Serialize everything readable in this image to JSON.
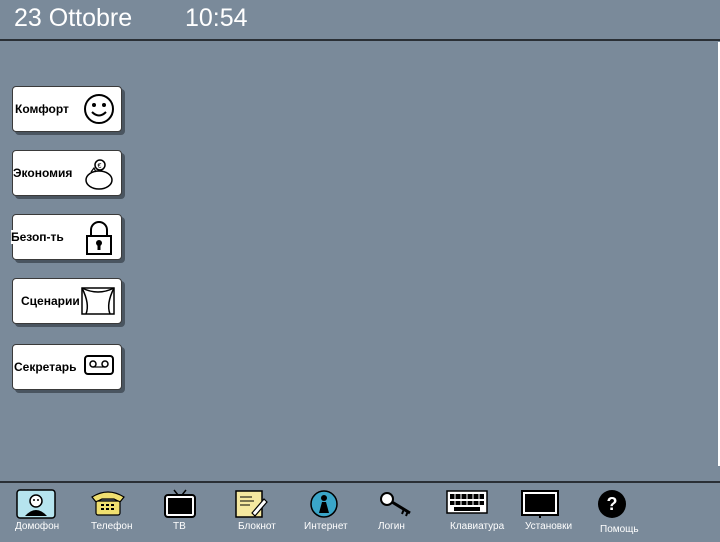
{
  "header": {
    "date": "23  Ottobre",
    "time": "10:54"
  },
  "menu": [
    {
      "label": "Комфорт",
      "icon": "smiley-icon"
    },
    {
      "label": "Экономия",
      "icon": "piggy-bank-icon"
    },
    {
      "label": "Безоп-ть",
      "icon": "padlock-icon"
    },
    {
      "label": "Сценарии",
      "icon": "theater-curtain-icon"
    },
    {
      "label": "Секретарь",
      "icon": "cassette-icon"
    }
  ],
  "dock": [
    {
      "label": "Домофон",
      "icon": "intercom-person-icon"
    },
    {
      "label": "Телефон",
      "icon": "telephone-icon"
    },
    {
      "label": "ТВ",
      "icon": "tv-icon"
    },
    {
      "label": "Блокнот",
      "icon": "notepad-pencil-icon"
    },
    {
      "label": "Интернет",
      "icon": "internet-globe-icon"
    },
    {
      "label": "Логин",
      "icon": "key-icon"
    },
    {
      "label": "Клавиатура",
      "icon": "keyboard-icon"
    },
    {
      "label": "Установки",
      "icon": "monitor-settings-icon"
    },
    {
      "label": "Помощь",
      "icon": "help-question-icon"
    }
  ],
  "colors": {
    "background": "#7a8a9a",
    "button_face": "#ffffff",
    "shadow": "#4a5560"
  }
}
